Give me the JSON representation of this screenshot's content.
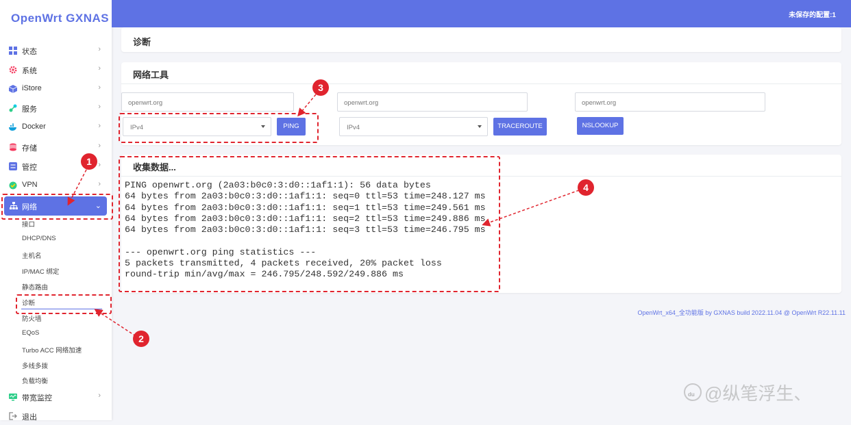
{
  "brand": "OpenWrt GXNAS",
  "header": {
    "unsaved": "未保存的配置:1"
  },
  "sidebar": {
    "items": [
      {
        "label": "状态",
        "icon": "dashboard-icon",
        "color": "#5e72e4"
      },
      {
        "label": "系统",
        "icon": "gear-icon",
        "color": "#f5365c"
      },
      {
        "label": "iStore",
        "icon": "cube-icon",
        "color": "#5e72e4"
      },
      {
        "label": "服务",
        "icon": "services-icon",
        "color": "#2dce89"
      },
      {
        "label": "Docker",
        "icon": "docker-icon",
        "color": "#11a0db"
      },
      {
        "label": "存储",
        "icon": "database-icon",
        "color": "#f5365c"
      },
      {
        "label": "管控",
        "icon": "control-icon",
        "color": "#5e72e4"
      },
      {
        "label": "VPN",
        "icon": "vpn-icon",
        "color": "#2dce89"
      },
      {
        "label": "网络",
        "icon": "network-icon",
        "color": "#ffffff"
      },
      {
        "label": "带宽监控",
        "icon": "monitor-icon",
        "color": "#2dce89"
      },
      {
        "label": "退出",
        "icon": "logout-icon",
        "color": "#888888"
      }
    ],
    "network_sub": [
      "接口",
      "DHCP/DNS",
      "主机名",
      "IP/MAC 绑定",
      "静态路由",
      "诊断",
      "防火墙",
      "EQoS",
      "Turbo ACC 网络加速",
      "多线多拨",
      "负载均衡"
    ]
  },
  "page": {
    "title": "诊断",
    "tools_title": "网络工具",
    "ping": {
      "host": "openwrt.org",
      "proto": "IPv4",
      "button": "PING"
    },
    "traceroute": {
      "host": "openwrt.org",
      "proto": "IPv4",
      "button": "TRACEROUTE"
    },
    "nslookup": {
      "host": "openwrt.org",
      "button": "NSLOOKUP"
    },
    "output_title": "收集数据...",
    "output": "PING openwrt.org (2a03:b0c0:3:d0::1af1:1): 56 data bytes\n64 bytes from 2a03:b0c0:3:d0::1af1:1: seq=0 ttl=53 time=248.127 ms\n64 bytes from 2a03:b0c0:3:d0::1af1:1: seq=1 ttl=53 time=249.561 ms\n64 bytes from 2a03:b0c0:3:d0::1af1:1: seq=2 ttl=53 time=249.886 ms\n64 bytes from 2a03:b0c0:3:d0::1af1:1: seq=3 ttl=53 time=246.795 ms\n\n--- openwrt.org ping statistics ---\n5 packets transmitted, 4 packets received, 20% packet loss\nround-trip min/avg/max = 246.795/248.592/249.886 ms"
  },
  "footer": "OpenWrt_x64_全功能版 by GXNAS build 2022.11.04 @ OpenWrt R22.11.11",
  "annotations": {
    "b1": "1",
    "b2": "2",
    "b3": "3",
    "b4": "4"
  },
  "watermark": "@纵笔浮生、",
  "watermark_logo": "du"
}
